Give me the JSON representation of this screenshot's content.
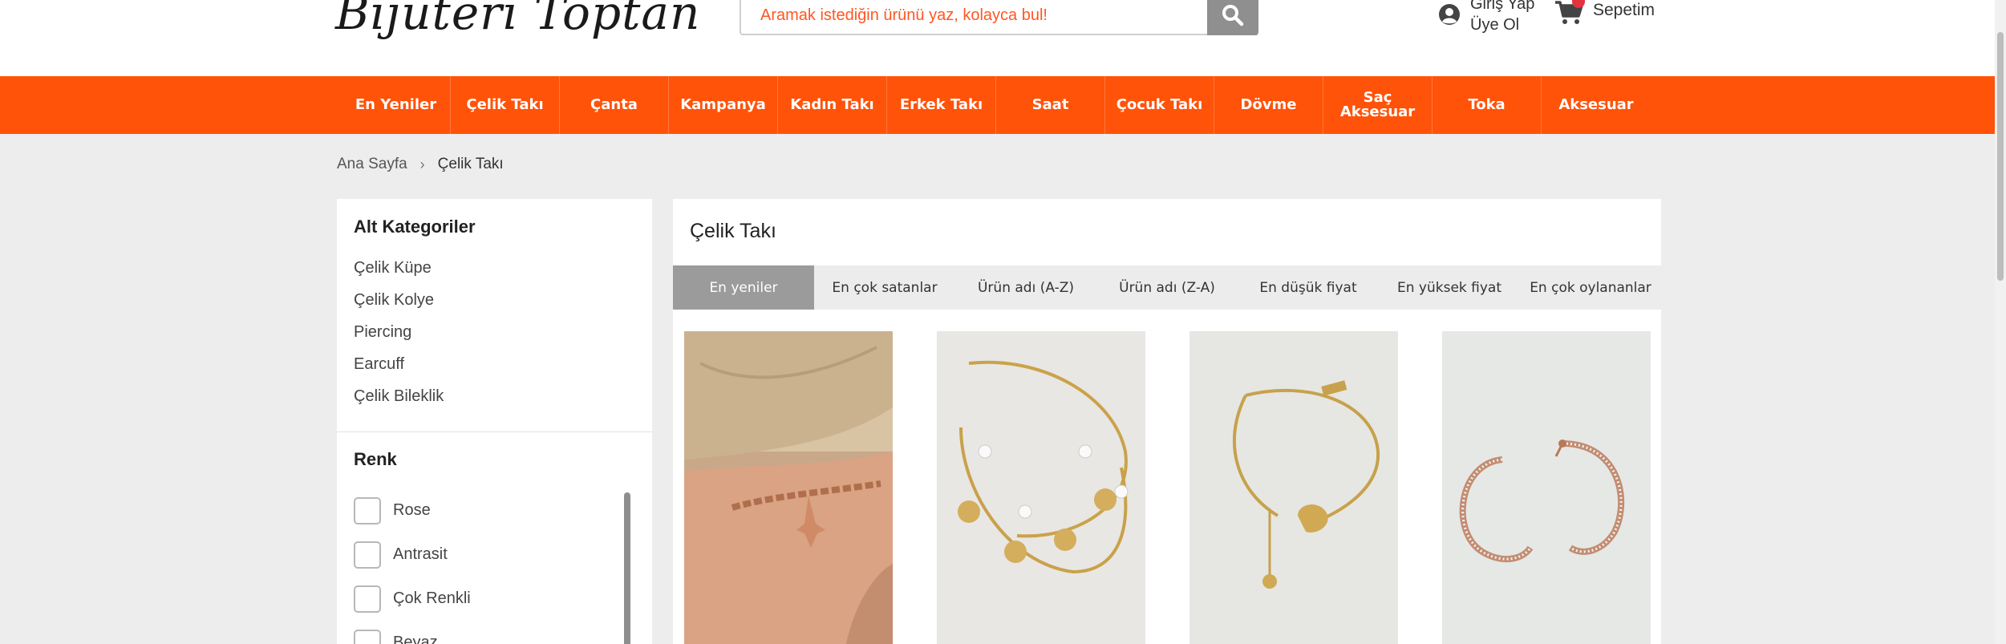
{
  "header": {
    "logo_text": "Bijuteri Toptan",
    "search": {
      "placeholder": "Aramak istediğin ürünü yaz, kolayca bul!",
      "button_icon": "search-icon"
    },
    "account": {
      "line1": "Giriş Yap",
      "line2": "Üye Ol",
      "icon": "user-circle-icon"
    },
    "cart": {
      "label": "Sepetim",
      "icon": "cart-icon",
      "badge_color": "#e5323f"
    }
  },
  "nav": {
    "background": "#ff5309",
    "items": [
      {
        "label": "En Yeniler"
      },
      {
        "label": "Çelik Takı"
      },
      {
        "label": "Çanta"
      },
      {
        "label": "Kampanya"
      },
      {
        "label": "Kadın Takı"
      },
      {
        "label": "Erkek Takı"
      },
      {
        "label": "Saat"
      },
      {
        "label": "Çocuk Takı"
      },
      {
        "label": "Dövme"
      },
      {
        "label": "Saç Aksesuar"
      },
      {
        "label": "Toka"
      },
      {
        "label": "Aksesuar"
      }
    ]
  },
  "breadcrumb": {
    "home": "Ana Sayfa",
    "separator": "›",
    "current": "Çelik Takı"
  },
  "sidebar": {
    "subcategories_title": "Alt Kategoriler",
    "subcategories": [
      {
        "label": "Çelik Küpe"
      },
      {
        "label": "Çelik Kolye"
      },
      {
        "label": "Piercing"
      },
      {
        "label": "Earcuff"
      },
      {
        "label": "Çelik Bileklik"
      }
    ],
    "color_title": "Renk",
    "colors": [
      {
        "label": "Rose"
      },
      {
        "label": "Antrasit"
      },
      {
        "label": "Çok Renkli"
      },
      {
        "label": "Beyaz"
      }
    ]
  },
  "main": {
    "title": "Çelik Takı",
    "sort_tabs": [
      {
        "label": "En yeniler",
        "active": true
      },
      {
        "label": "En çok satanlar"
      },
      {
        "label": "Ürün adı (A-Z)"
      },
      {
        "label": "Ürün adı (Z-A)"
      },
      {
        "label": "En düşük fiyat"
      },
      {
        "label": "En yüksek fiyat"
      },
      {
        "label": "En çok oylananlar"
      }
    ],
    "products": [
      {
        "image": "rose-gold-bracelet-on-wrist"
      },
      {
        "image": "gold-pearl-layered-bracelet"
      },
      {
        "image": "gold-chain-bracelet-elephant-charm"
      },
      {
        "image": "crystal-hoop-earrings"
      }
    ]
  }
}
